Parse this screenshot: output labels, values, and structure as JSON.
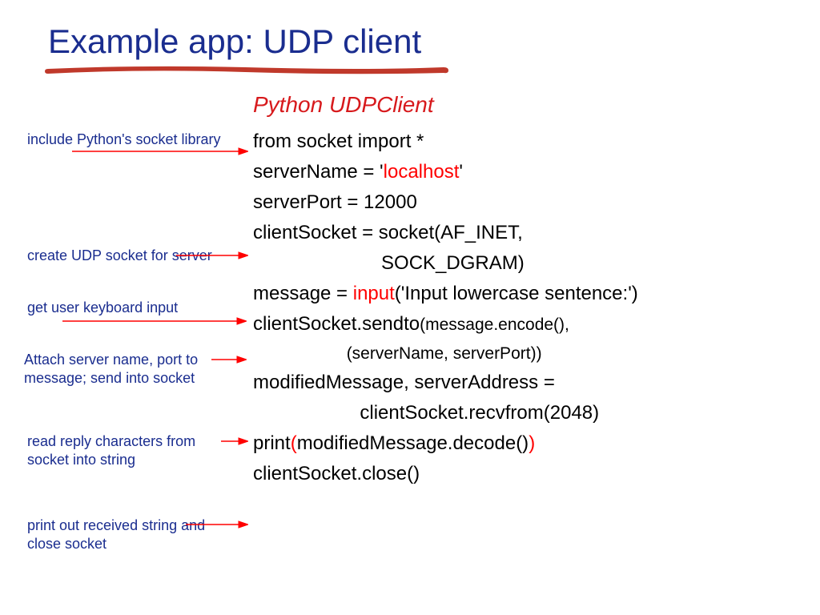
{
  "title": "Example app: UDP client",
  "subhead": "Python UDPClient",
  "code": {
    "l1": "from socket import *",
    "l2a": "serverName = '",
    "l2b": "localhost",
    "l2c": "'",
    "l3": "serverPort = 12000",
    "l4": "clientSocket = socket(AF_INET,",
    "l5": "                        SOCK_DGRAM)",
    "l6a": "message = ",
    "l6b": "input",
    "l6c": "('Input lowercase sentence:')",
    "l7a": "clientSocket.sendto",
    "l7b": "(message.encode(),",
    "l8": "                    (serverName, serverPort))",
    "l9": "modifiedMessage, serverAddress =",
    "l10": "                    clientSocket.recvfrom(2048)",
    "l11a": "print",
    "l11b": "(",
    "l11c": "modifiedMessage.decode()",
    "l11d": ")",
    "l12": "clientSocket.close()"
  },
  "annot": {
    "a1": "include Python's socket library",
    "a2": "create UDP socket for server",
    "a3": "get user keyboard input",
    "a4": "Attach server name, port to message; send into socket",
    "a5": "read reply characters from socket into string",
    "a6": "print out received string and close socket"
  }
}
